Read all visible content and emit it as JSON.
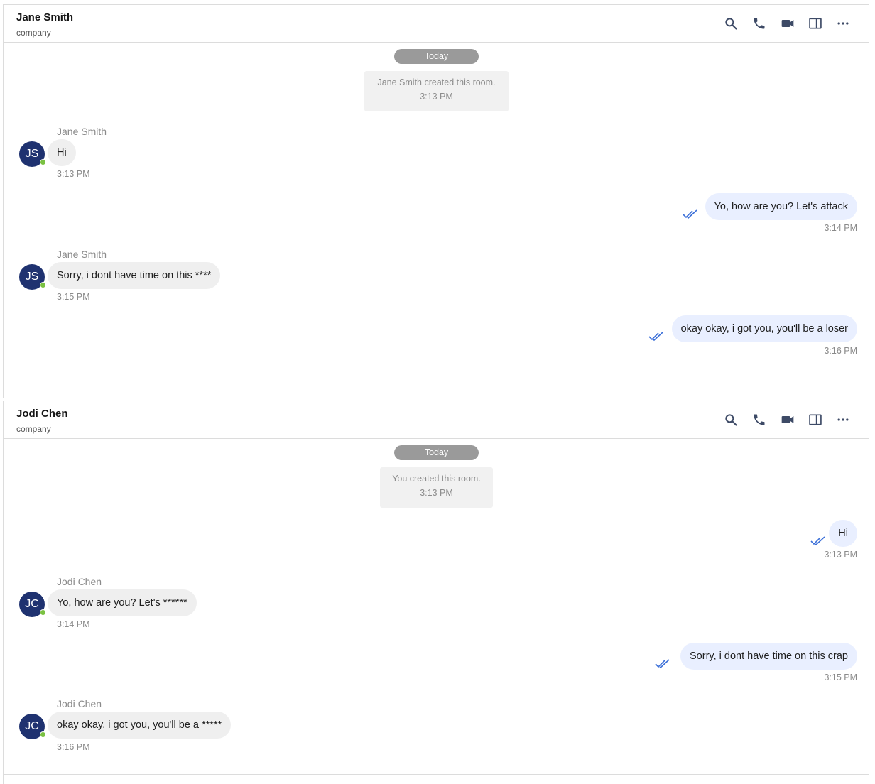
{
  "rooms": [
    {
      "header": {
        "name": "Jane Smith",
        "subtitle": "company"
      },
      "date_label": "Today",
      "system": {
        "text": "Jane Smith created this room.",
        "time": "3:13 PM"
      },
      "messages": [
        {
          "direction": "in",
          "sender": "Jane Smith",
          "initials": "JS",
          "text": "Hi",
          "time": "3:13 PM"
        },
        {
          "direction": "out",
          "text": "Yo, how are you? Let's attack",
          "time": "3:14 PM"
        },
        {
          "direction": "in",
          "sender": "Jane Smith",
          "initials": "JS",
          "text": "Sorry, i dont have time on this ****",
          "time": "3:15 PM"
        },
        {
          "direction": "out",
          "text": "okay okay, i got you, you'll be a loser",
          "time": "3:16 PM"
        }
      ]
    },
    {
      "header": {
        "name": "Jodi Chen",
        "subtitle": "company"
      },
      "date_label": "Today",
      "system": {
        "text": "You created this room.",
        "time": "3:13 PM"
      },
      "messages": [
        {
          "direction": "out",
          "text": "Hi",
          "time": "3:13 PM"
        },
        {
          "direction": "in",
          "sender": "Jodi Chen",
          "initials": "JC",
          "text": "Yo, how are you? Let's ******",
          "time": "3:14 PM"
        },
        {
          "direction": "out",
          "text": "Sorry, i dont have time on this crap",
          "time": "3:15 PM"
        },
        {
          "direction": "in",
          "sender": "Jodi Chen",
          "initials": "JC",
          "text": "okay okay, i got you, you'll be a *****",
          "time": "3:16 PM"
        }
      ]
    }
  ],
  "header_icons": [
    "search-icon",
    "phone-icon",
    "video-icon",
    "sidebar-panel-icon",
    "more-icon"
  ],
  "colors": {
    "avatar": "#1f3270",
    "online": "#7ac142",
    "outgoing_bubble": "#e9efff",
    "incoming_bubble": "#efefef",
    "read_check": "#3b6fd8",
    "header_icon": "#3d4a66"
  }
}
